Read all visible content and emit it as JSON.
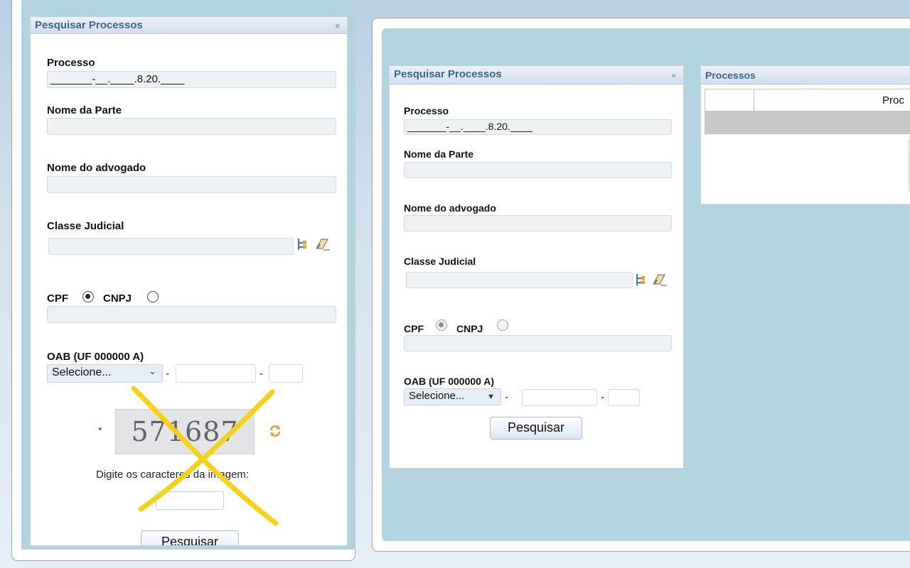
{
  "left_panel": {
    "title": "Pesquisar Processos",
    "collapse_label": "«",
    "processo_label": "Processo",
    "processo_value": "_______-__.____.8.20.____",
    "nome_parte_label": "Nome da Parte",
    "nome_advogado_label": "Nome do advogado",
    "classe_judicial_label": "Classe Judicial",
    "cpf_label": "CPF",
    "cnpj_label": "CNPJ",
    "oab_label": "OAB (UF 000000 A)",
    "oab_select_value": "Selecione...",
    "oab_select_arrow": "⌄",
    "dash": "-",
    "captcha_required_mark": "*",
    "captcha_text": "571687",
    "captcha_prompt": "Digite os caracteres da imagem:",
    "search_button": "Pesquisar"
  },
  "right_panel": {
    "title": "Pesquisar Processos",
    "collapse_label": "«",
    "processo_label": "Processo",
    "processo_value": "_______-__.____.8.20.____",
    "nome_parte_label": "Nome da Parte",
    "nome_advogado_label": "Nome do advogado",
    "classe_judicial_label": "Classe Judicial",
    "cpf_label": "CPF",
    "cnpj_label": "CNPJ",
    "oab_label": "OAB (UF 000000 A)",
    "oab_select_value": "Selecione...",
    "oab_select_arrow": "▼",
    "dash": "-",
    "search_button": "Pesquisar"
  },
  "processos_panel": {
    "title": "Processos",
    "column_header": "Proc"
  },
  "icons": {
    "refresh": "refresh-icon",
    "tree": "tree-icon",
    "eraser": "eraser-icon",
    "annotation": "yellow-x-mark"
  },
  "colors": {
    "accent": "#3a6592",
    "annotation": "#f5d117",
    "required": "#cc0000",
    "frame_bg": "#b3d4df"
  }
}
